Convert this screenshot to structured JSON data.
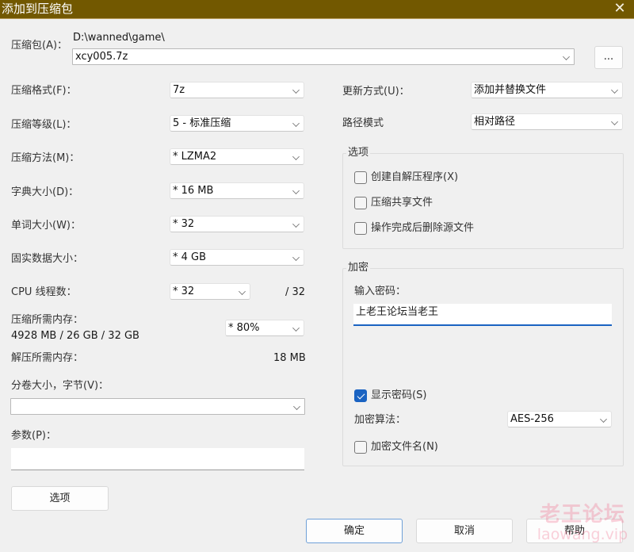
{
  "window": {
    "title": "添加到压缩包",
    "close_icon": "close-icon"
  },
  "archive": {
    "label": "压缩包(A)：",
    "path": "D:\\wanned\\game\\",
    "filename": "xcy005.7z",
    "browse_label": "..."
  },
  "left": {
    "format": {
      "label": "压缩格式(F)：",
      "value": "7z"
    },
    "level": {
      "label": "压缩等级(L)：",
      "value": "5 - 标准压缩"
    },
    "method": {
      "label": "压缩方法(M)：",
      "value": "*  LZMA2"
    },
    "dict": {
      "label": "字典大小(D)：",
      "value": "*  16 MB"
    },
    "word": {
      "label": "单词大小(W)：",
      "value": "*  32"
    },
    "solid": {
      "label": "固实数据大小：",
      "value": "*  4 GB"
    },
    "cpu": {
      "label": "CPU 线程数：",
      "value": "*  32",
      "max": "/ 32"
    },
    "mem_compress": {
      "label": "压缩所需内存：",
      "value": "4928 MB / 26 GB / 32 GB",
      "limit": "*  80%"
    },
    "mem_decompress": {
      "label": "解压所需内存：",
      "value": "18 MB"
    },
    "volume": {
      "label": "分卷大小，字节(V)：",
      "value": ""
    },
    "params": {
      "label": "参数(P)：",
      "value": ""
    },
    "options_button": "选项"
  },
  "right": {
    "update": {
      "label": "更新方式(U)：",
      "value": "添加并替换文件"
    },
    "pathmode": {
      "label": "路径模式",
      "value": "相对路径"
    },
    "options_group": {
      "legend": "选项",
      "items": [
        {
          "label": "创建自解压程序(X)",
          "checked": false
        },
        {
          "label": "压缩共享文件",
          "checked": false
        },
        {
          "label": "操作完成后删除源文件",
          "checked": false
        }
      ]
    },
    "encryption": {
      "legend": "加密",
      "password_label": "输入密码：",
      "password_value": "上老王论坛当老王",
      "show_password": {
        "label": "显示密码(S)",
        "checked": true
      },
      "method_label": "加密算法：",
      "method_value": "AES-256",
      "encrypt_names": {
        "label": "加密文件名(N)",
        "checked": false
      }
    }
  },
  "buttons": {
    "ok": "确定",
    "cancel": "取消",
    "help": "帮助"
  },
  "watermark": {
    "cn": "老王论坛",
    "en": "laowang.vip"
  },
  "colors": {
    "titlebar": "#725800",
    "accent": "#1a63c2",
    "watermark": "#f078964d"
  }
}
